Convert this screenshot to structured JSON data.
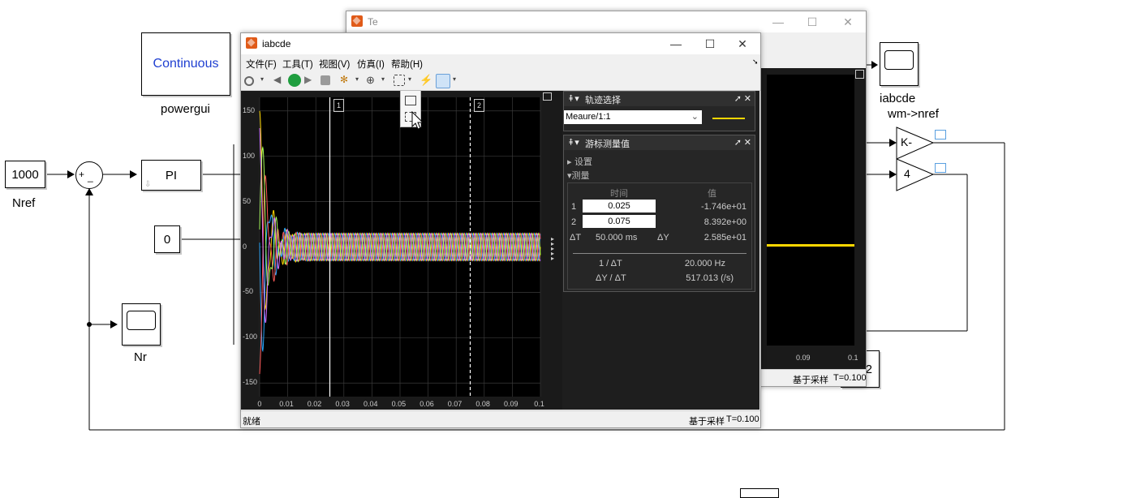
{
  "diagram": {
    "powergui_block": "Continuous",
    "powergui_label": "powergui",
    "nref_block": "1000",
    "nref_label": "Nref",
    "sum_signs": [
      "+",
      "_"
    ],
    "pi_block": "PI",
    "const_block": "0",
    "nr_label": "Nr",
    "scope_iabcde_label": "iabcde",
    "gain_k_label": "wm->nref",
    "gain_k": "K-",
    "gain_4": "4",
    "partial_block": "2"
  },
  "te_window": {
    "title": "Te",
    "x_ticks": [
      "0.09",
      "0.1"
    ],
    "status_mode": "基于采样",
    "status_time": "T=0.100"
  },
  "scope_window": {
    "title": "iabcde",
    "menu": [
      "文件(F)",
      "工具(T)",
      "视图(V)",
      "仿真(I)",
      "帮助(H)"
    ],
    "status_ready": "就绪",
    "status_mode": "基于采样",
    "status_time": "T=0.100",
    "cursor1_label": "1",
    "cursor2_label": "2",
    "y_ticks": [
      "150",
      "100",
      "50",
      "0",
      "-50",
      "-100",
      "-150"
    ],
    "x_ticks": [
      "0",
      "0.01",
      "0.02",
      "0.03",
      "0.04",
      "0.05",
      "0.06",
      "0.07",
      "0.08",
      "0.09",
      "0.1"
    ]
  },
  "chart_data": {
    "type": "line",
    "xlim": [
      0,
      0.1
    ],
    "ylim": [
      -165,
      165
    ],
    "grid": true,
    "steady_amplitude": 15,
    "frequency_hz": 450,
    "phases": 5,
    "colors": [
      "#ffd700",
      "#29a8ff",
      "#ff5a5a",
      "#a8ff5a",
      "#d070ff"
    ],
    "cursor1_x": 0.025,
    "cursor2_x": 0.075
  },
  "trace_panel": {
    "title": "轨迹选择",
    "selected": "Meaure/1:1"
  },
  "cursor_panel": {
    "title": "游标测量值",
    "settings": "设置",
    "measurements": "测量",
    "col_time": "时间",
    "col_value": "值",
    "row1_index": "1",
    "row1_time": "0.025",
    "row1_value": "-1.746e+01",
    "row2_index": "2",
    "row2_time": "0.075",
    "row2_value": "8.392e+00",
    "dt_label": "ΔT",
    "dt_value": "50.000 ms",
    "dy_label": "ΔY",
    "dy_value": "2.585e+01",
    "inv_dt_label": "1 / ΔT",
    "inv_dt_value": "20.000 Hz",
    "slope_label": "ΔY / ΔT",
    "slope_value": "517.013 (/s)"
  },
  "colors": {
    "accent_blue": "#1f5fd1",
    "trace_yellow": "#ffd700"
  }
}
